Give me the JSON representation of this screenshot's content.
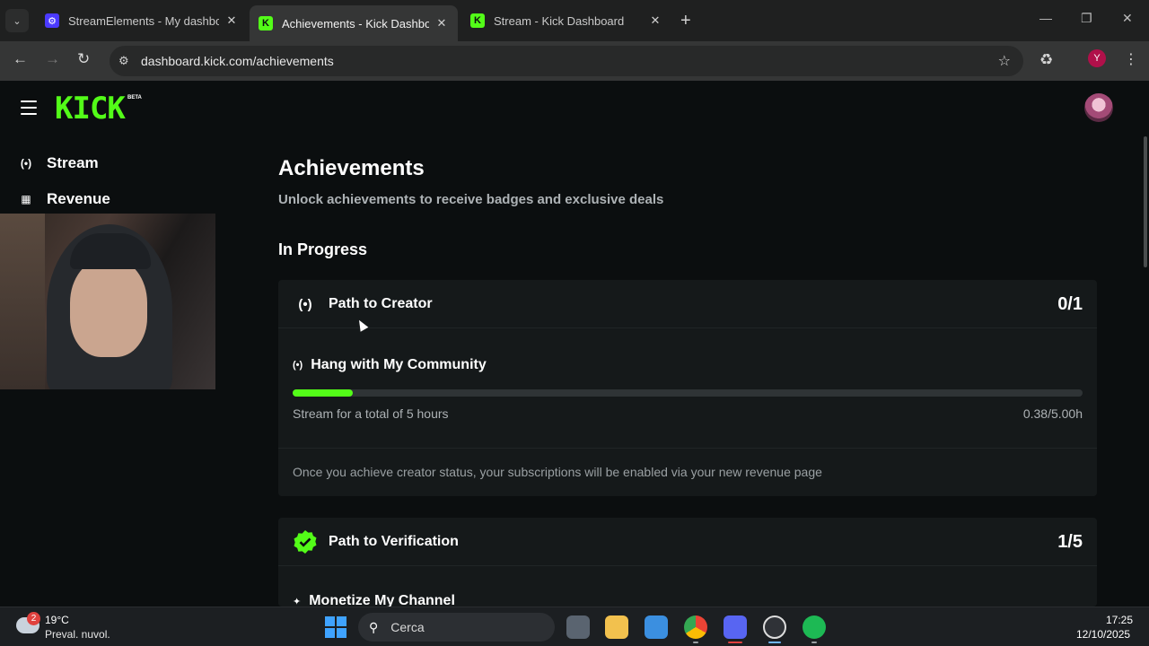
{
  "browser": {
    "tabs": [
      {
        "title": "StreamElements - My dashboard",
        "favicon": "streamelements-icon"
      },
      {
        "title": "Achievements - Kick Dashboard",
        "favicon": "kick-icon",
        "active": true
      },
      {
        "title": "Stream - Kick Dashboard",
        "favicon": "kick-icon"
      }
    ],
    "new_tab": "+",
    "url": "dashboard.kick.com/achievements",
    "profile_initial": "Y"
  },
  "header": {
    "logo": "KICK",
    "logo_badge": "BETA"
  },
  "sidebar": {
    "items": [
      {
        "label": "Stream",
        "icon": "broadcast-icon"
      },
      {
        "label": "Revenue",
        "icon": "chart-icon"
      }
    ]
  },
  "main": {
    "title": "Achievements",
    "subtitle": "Unlock achievements to receive badges and exclusive deals",
    "section": "In Progress",
    "cards": [
      {
        "title": "Path to Creator",
        "count": "0/1",
        "task": {
          "title": "Hang with My Community",
          "progress": 0.076,
          "description": "Stream for a total of 5 hours",
          "value": "0.38/5.00h"
        },
        "footer": "Once you achieve creator status, your subscriptions will be enabled via your new revenue page"
      },
      {
        "title": "Path to Verification",
        "count": "1/5",
        "task": {
          "title": "Monetize My Channel"
        }
      }
    ]
  },
  "taskbar": {
    "weather_badge": "2",
    "temperature": "19°C",
    "weather_desc": "Preval. nuvol.",
    "search_placeholder": "Cerca",
    "time": "17:25",
    "date": "12/10/2025"
  },
  "colors": {
    "accent": "#53fc18",
    "background": "#0b0e0f",
    "card": "#15191a",
    "muted_text": "#adb2b5"
  }
}
